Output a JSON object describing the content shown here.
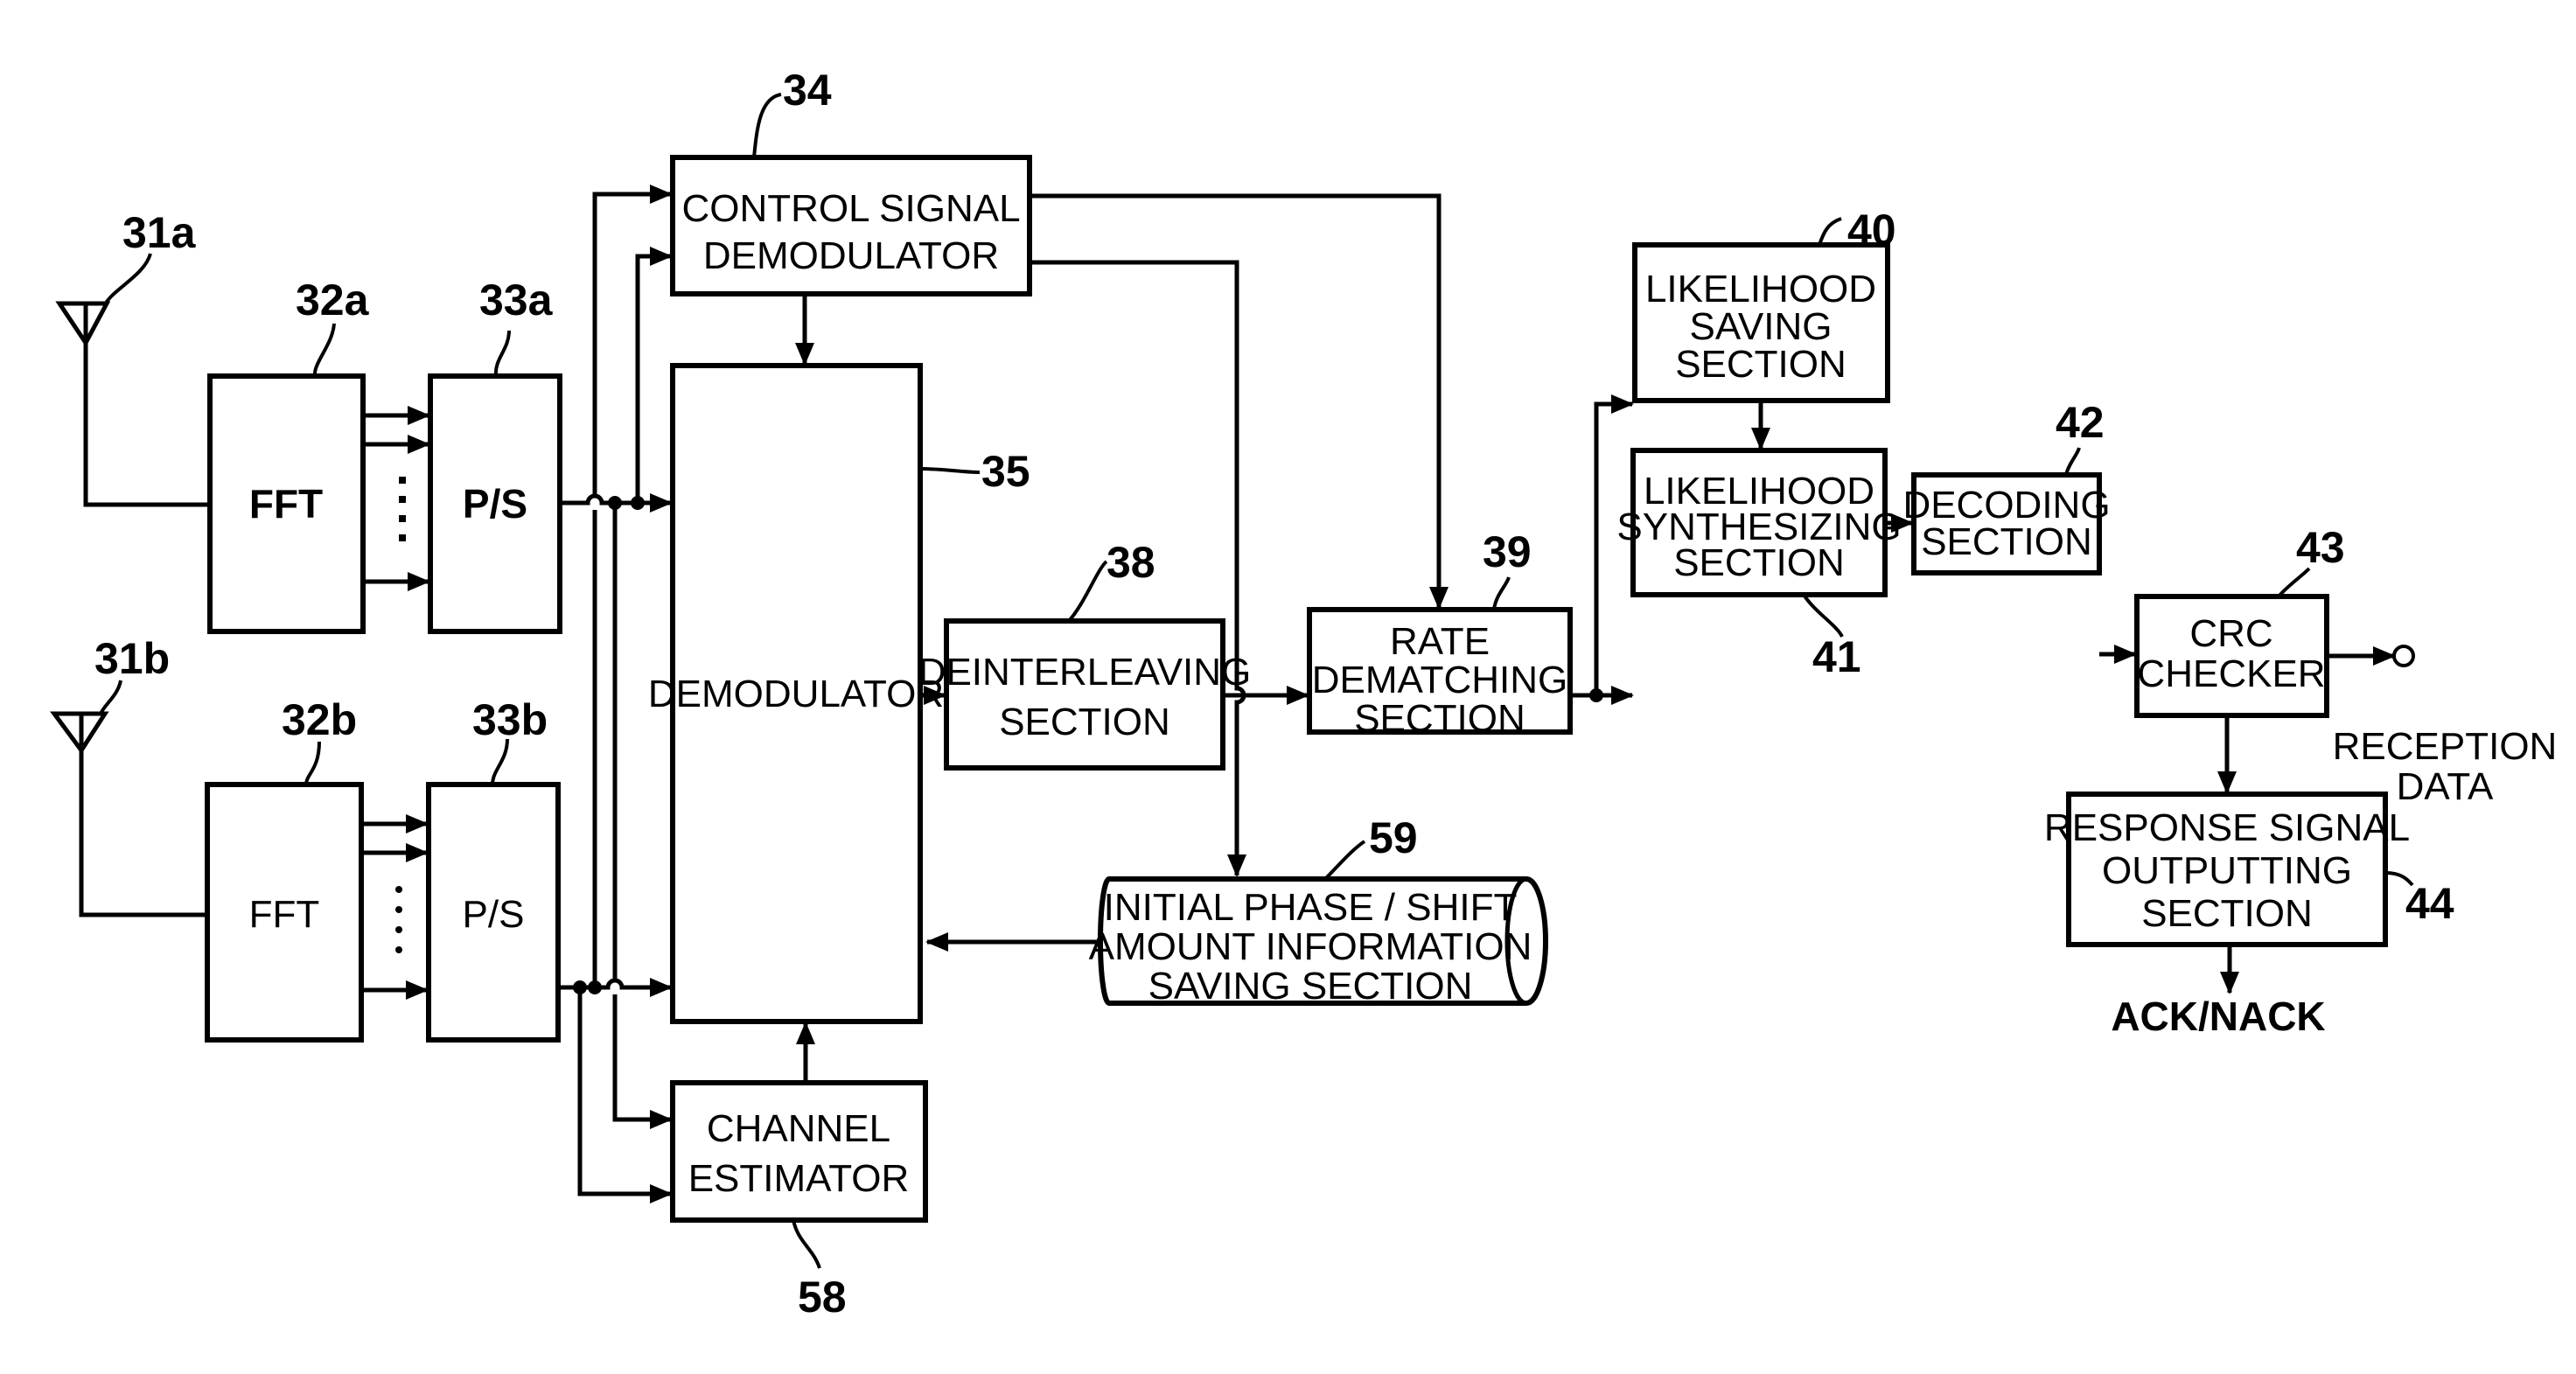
{
  "blocks": {
    "fft_a": {
      "ref": "32a",
      "label": "FFT"
    },
    "ps_a": {
      "ref": "33a",
      "label": "P/S"
    },
    "fft_b": {
      "ref": "32b",
      "label": "FFT"
    },
    "ps_b": {
      "ref": "33b",
      "label": "P/S"
    },
    "antenna_a": {
      "ref": "31a"
    },
    "antenna_b": {
      "ref": "31b"
    },
    "control_signal_demodulator": {
      "ref": "34",
      "lines": [
        "CONTROL SIGNAL",
        "DEMODULATOR"
      ]
    },
    "demodulator": {
      "ref": "35",
      "lines": [
        "DEMODULATOR"
      ]
    },
    "deinterleaving": {
      "ref": "38",
      "lines": [
        "DEINTERLEAVING",
        "SECTION"
      ]
    },
    "rate_dematching": {
      "ref": "39",
      "lines": [
        "RATE",
        "DEMATCHING",
        "SECTION"
      ]
    },
    "likelihood_saving": {
      "ref": "40",
      "lines": [
        "LIKELIHOOD",
        "SAVING",
        "SECTION"
      ]
    },
    "likelihood_synthesizing": {
      "ref": "41",
      "lines": [
        "LIKELIHOOD",
        "SYNTHESIZING",
        "SECTION"
      ]
    },
    "decoding": {
      "ref": "42",
      "lines": [
        "DECODING",
        "SECTION"
      ]
    },
    "crc_checker": {
      "ref": "43",
      "lines": [
        "CRC",
        "CHECKER"
      ]
    },
    "response_signal": {
      "ref": "44",
      "lines": [
        "RESPONSE SIGNAL",
        "OUTPUTTING",
        "SECTION"
      ]
    },
    "channel_estimator": {
      "ref": "58",
      "lines": [
        "CHANNEL",
        "ESTIMATOR"
      ]
    },
    "phase_shift_saving": {
      "ref": "59",
      "lines": [
        "INITIAL PHASE / SHIFT",
        "AMOUNT INFORMATION",
        "SAVING SECTION"
      ]
    }
  },
  "outputs": {
    "reception_data": [
      "RECEPTION",
      "DATA"
    ],
    "ack_nack": "ACK/NACK"
  }
}
